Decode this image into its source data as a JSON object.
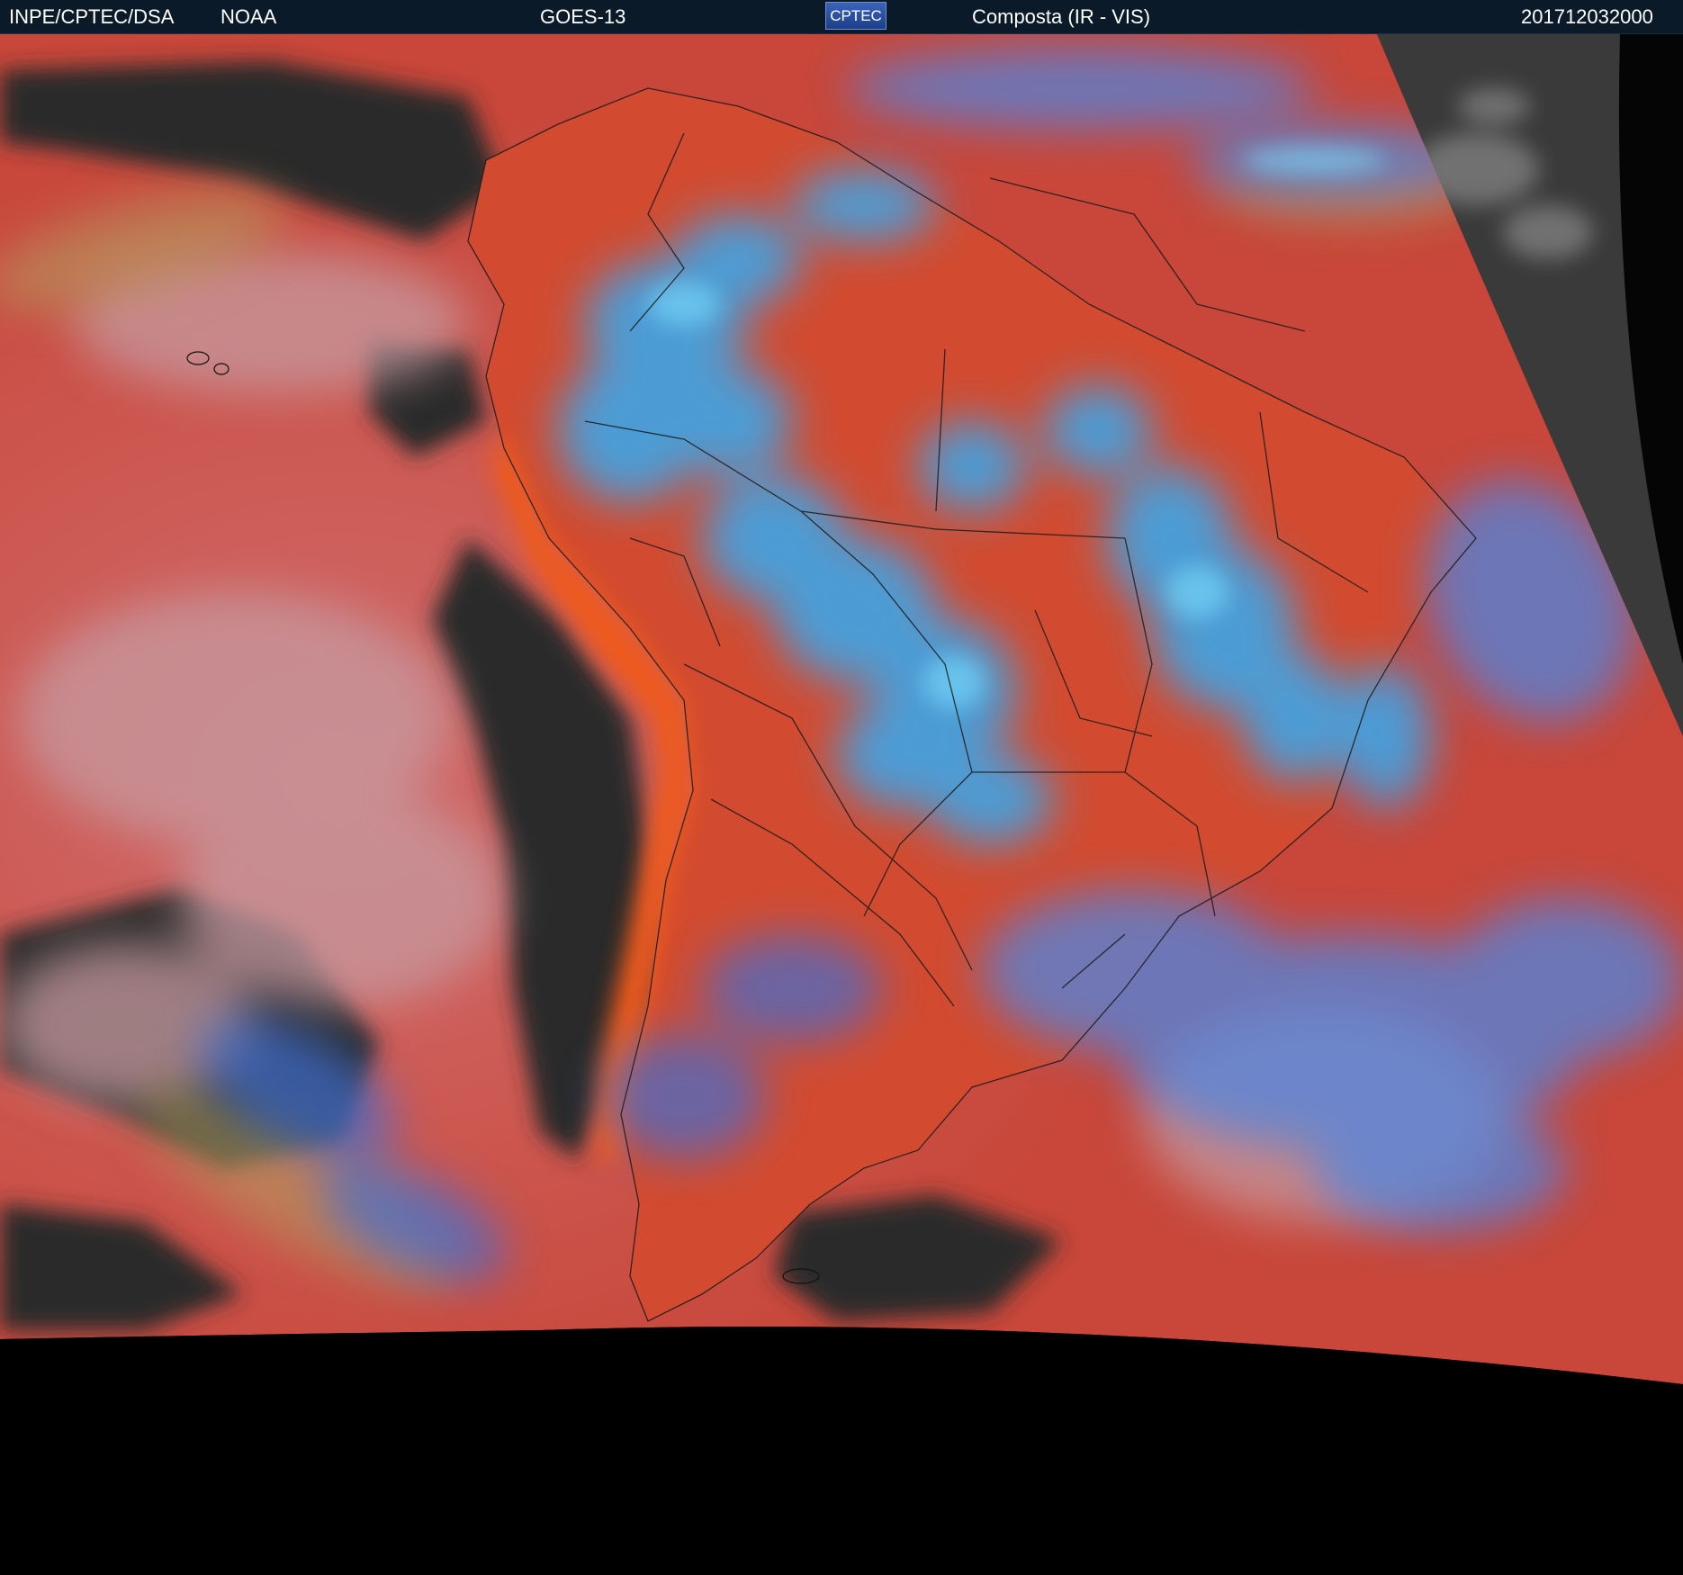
{
  "header": {
    "agency": "INPE/CPTEC/DSA",
    "source": "NOAA",
    "satellite": "GOES-13",
    "logo_text": "CPTEC",
    "product": "Composta (IR - VIS)",
    "timestamp": "201712032000"
  },
  "colors": {
    "header_background": "#0b1a28",
    "space_background": "#000000",
    "clear_ocean": "#2a2a2a",
    "warm_surface": "#c8473a",
    "hot_land": "#e2532a",
    "low_cloud": "#c09078",
    "high_cold_cloud": "#35a9f0",
    "mid_cloud": "#4f7fd8",
    "borders": "#1a1a1a"
  }
}
